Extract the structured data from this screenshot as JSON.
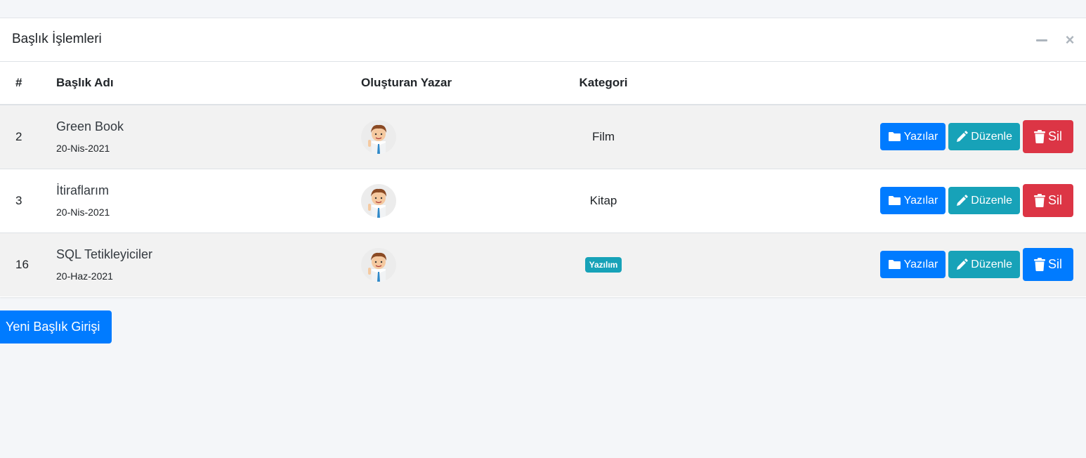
{
  "card": {
    "title": "Başlık İşlemleri",
    "minimize_icon": "minus-icon",
    "close_icon": "times-icon"
  },
  "table": {
    "headers": {
      "id": "#",
      "title": "Başlık Adı",
      "author": "Oluşturan Yazar",
      "category": "Kategori"
    },
    "rows": [
      {
        "id": "2",
        "title": "Green Book",
        "date": "20-Nis-2021",
        "category": "Film",
        "category_badge": false,
        "delete_color": "#dc3545"
      },
      {
        "id": "3",
        "title": "İtiraflarım",
        "date": "20-Nis-2021",
        "category": "Kitap",
        "category_badge": false,
        "delete_color": "#dc3545"
      },
      {
        "id": "16",
        "title": "SQL Tetikleyiciler",
        "date": "20-Haz-2021",
        "category": "Yazılım",
        "category_badge": true,
        "delete_color": "#007bff"
      }
    ],
    "buttons": {
      "posts": "Yazılar",
      "edit": "Düzenle",
      "delete": "Sil"
    }
  },
  "new_button": "Yeni Başlık Girişi",
  "colors": {
    "primary": "#007bff",
    "info": "#17a2b8",
    "danger": "#dc3545",
    "stripe": "#f2f2f2",
    "background": "#f4f6f9"
  }
}
